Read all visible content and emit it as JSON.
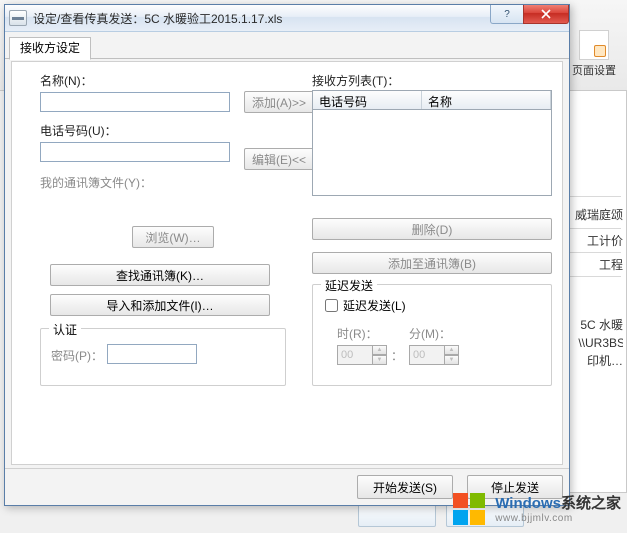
{
  "window": {
    "title": "设定/查看传真发送：5C 水暖验工2015.1.17.xls",
    "help_glyph": "?",
    "close_label": "×"
  },
  "tabs": {
    "active": "接收方设定"
  },
  "left": {
    "name_label": "名称(N)：",
    "name_value": "",
    "add_btn": "添加(A)>>",
    "phone_label": "电话号码(U)：",
    "phone_value": "",
    "edit_btn": "编辑(E)<<",
    "book_file_label": "我的通讯簿文件(Y)：",
    "book_file_value": "",
    "browse_btn": "浏览(W)…",
    "find_book_btn": "查找通讯簿(K)…",
    "import_btn": "导入和添加文件(I)…",
    "auth_group": "认证",
    "pwd_label": "密码(P)：",
    "pwd_value": ""
  },
  "right": {
    "list_label": "接收方列表(T)：",
    "col_phone": "电话号码",
    "col_name": "名称",
    "delete_btn": "删除(D)",
    "add_to_book_btn": "添加至通讯簿(B)",
    "delay_group": "延迟发送",
    "delay_chk": "延迟发送(L)",
    "hour_label": "时(R)：",
    "min_label": "分(M)：",
    "hour_val": "00",
    "min_val": "00",
    "colon": "："
  },
  "footer": {
    "start": "开始发送(S)",
    "stop": "停止发送"
  },
  "bg": {
    "toolbtn": "页面设置",
    "line1": "威瑞庭颂",
    "line2": "工计价",
    "line3": "工程",
    "line4a": "：  5C 水暖",
    "line4b": "： \\\\UR3BS",
    "line4c": "印机…"
  },
  "watermark": {
    "brand_en": "Windows",
    "brand_cn": "系统之家",
    "url": "www.bjjmlv.com"
  }
}
